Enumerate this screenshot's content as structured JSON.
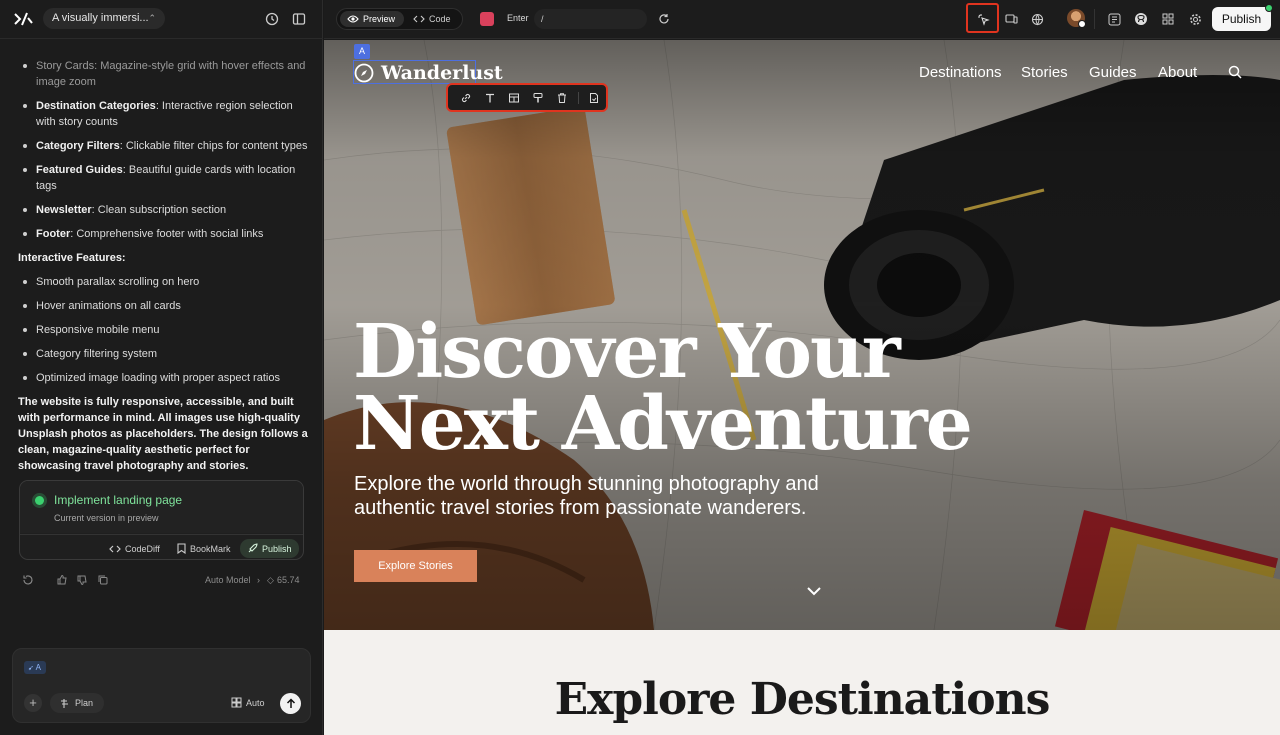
{
  "app": {
    "project_title": "A visually immersi...",
    "route_label": "Enter",
    "route_path": "/",
    "publish_label": "Publish",
    "view_modes": [
      "Preview",
      "Code"
    ]
  },
  "chat": {
    "list1": [
      {
        "bold": "Story Cards",
        "text": ": Magazine-style grid with hover effects and image zoom"
      },
      {
        "bold": "Destination Categories",
        "text": ": Interactive region selection with story counts"
      },
      {
        "bold": "Category Filters",
        "text": ": Clickable filter chips for content types"
      },
      {
        "bold": "Featured Guides",
        "text": ": Beautiful guide cards with location tags"
      },
      {
        "bold": "Newsletter",
        "text": ": Clean subscription section"
      },
      {
        "bold": "Footer",
        "text": ": Comprehensive footer with social links"
      }
    ],
    "section_heading": "Interactive Features:",
    "list2": [
      "Smooth parallax scrolling on hero",
      "Hover animations on all cards",
      "Responsive mobile menu",
      "Category filtering system",
      "Optimized image loading with proper aspect ratios"
    ],
    "summary": "The website is fully responsive, accessible, and built with performance in mind. All images use high-quality Unsplash photos as placeholders. The design follows a clean, magazine-quality aesthetic perfect for showcasing travel photography and stories."
  },
  "version_card": {
    "title": "Implement landing page",
    "subtitle": "Current version in preview",
    "actions": [
      "CodeDiff",
      "BookMark",
      "Publish"
    ]
  },
  "feedback": {
    "model": "Auto Model",
    "separator": "›",
    "credits": "65.74"
  },
  "composer": {
    "chip": "A",
    "plan_label": "Plan",
    "auto_label": "Auto"
  },
  "site": {
    "brand": "Wanderlust",
    "element_tag": "A",
    "nav": [
      "Destinations",
      "Stories",
      "Guides",
      "About"
    ],
    "headline": "Discover Your Next Adventure",
    "subheadline": "Explore the world through stunning photography and authentic travel stories from passionate wanderers.",
    "cta": "Explore Stories",
    "section_title": "Explore Destinations"
  },
  "colors": {
    "accent_red": "#e0341f",
    "selection_blue": "#4d6fe0",
    "success_green": "#3bd16f",
    "cta": "#d9825a"
  }
}
